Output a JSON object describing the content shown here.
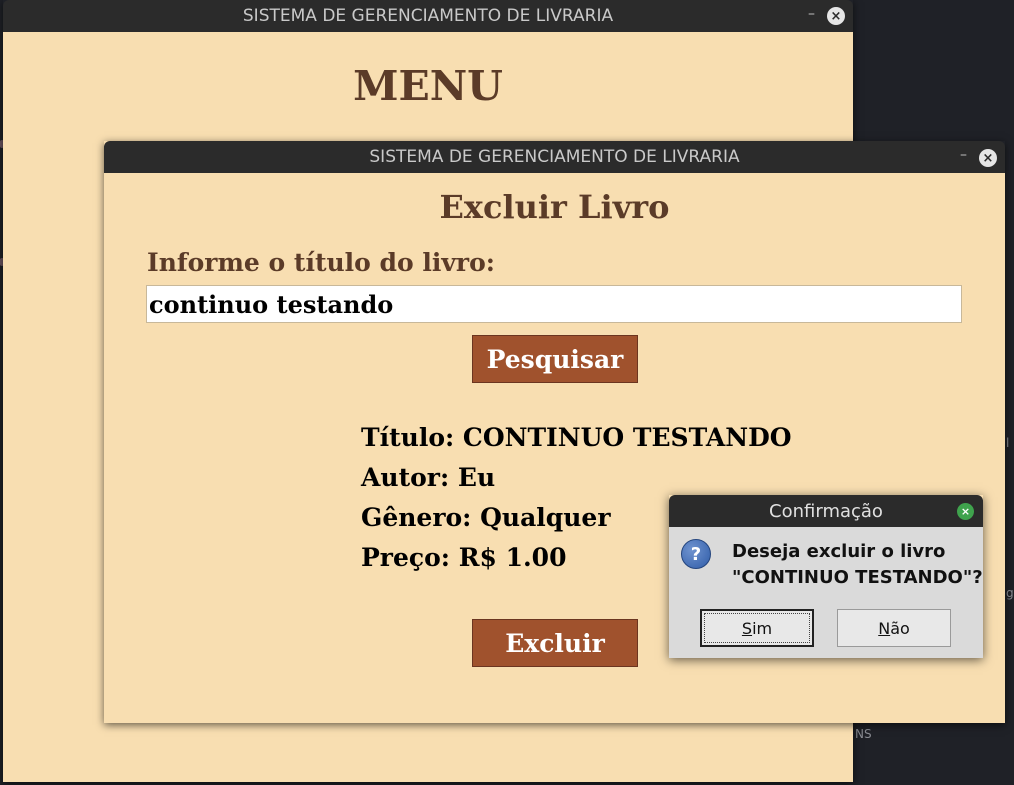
{
  "desktop": {
    "side_text_1": "l",
    "side_text_2": "g",
    "bottom_text": "NS"
  },
  "main_window": {
    "title": "SISTEMA DE GERENCIAMENTO DE LIVRARIA",
    "minimize": "–",
    "close": "×",
    "heading": "MENU"
  },
  "delete_window": {
    "title": "SISTEMA DE GERENCIAMENTO DE LIVRARIA",
    "minimize": "–",
    "close": "×",
    "heading": "Excluir Livro",
    "prompt_label": "Informe o título do livro:",
    "title_input_value": "continuo testando",
    "search_button": "Pesquisar",
    "details": {
      "titulo": "Título: CONTINUO TESTANDO",
      "autor": "Autor: Eu",
      "genero": "Gênero: Qualquer",
      "preco": "Preço: R$ 1.00"
    },
    "delete_button": "Excluir"
  },
  "dialog": {
    "title": "Confirmação",
    "close": "×",
    "icon": "question-icon",
    "icon_glyph": "?",
    "message_line1": "Deseja excluir o livro",
    "message_line2": "\"CONTINUO TESTANDO\"?",
    "yes_first": "S",
    "yes_rest": "im",
    "no_first": "N",
    "no_rest": "ão"
  },
  "colors": {
    "window_bg": "#f8deb1",
    "title_bar": "#2b2b2b",
    "heading_brown": "#5b3b28",
    "button_brown": "#a0522d",
    "dialog_bg": "#dadada"
  }
}
